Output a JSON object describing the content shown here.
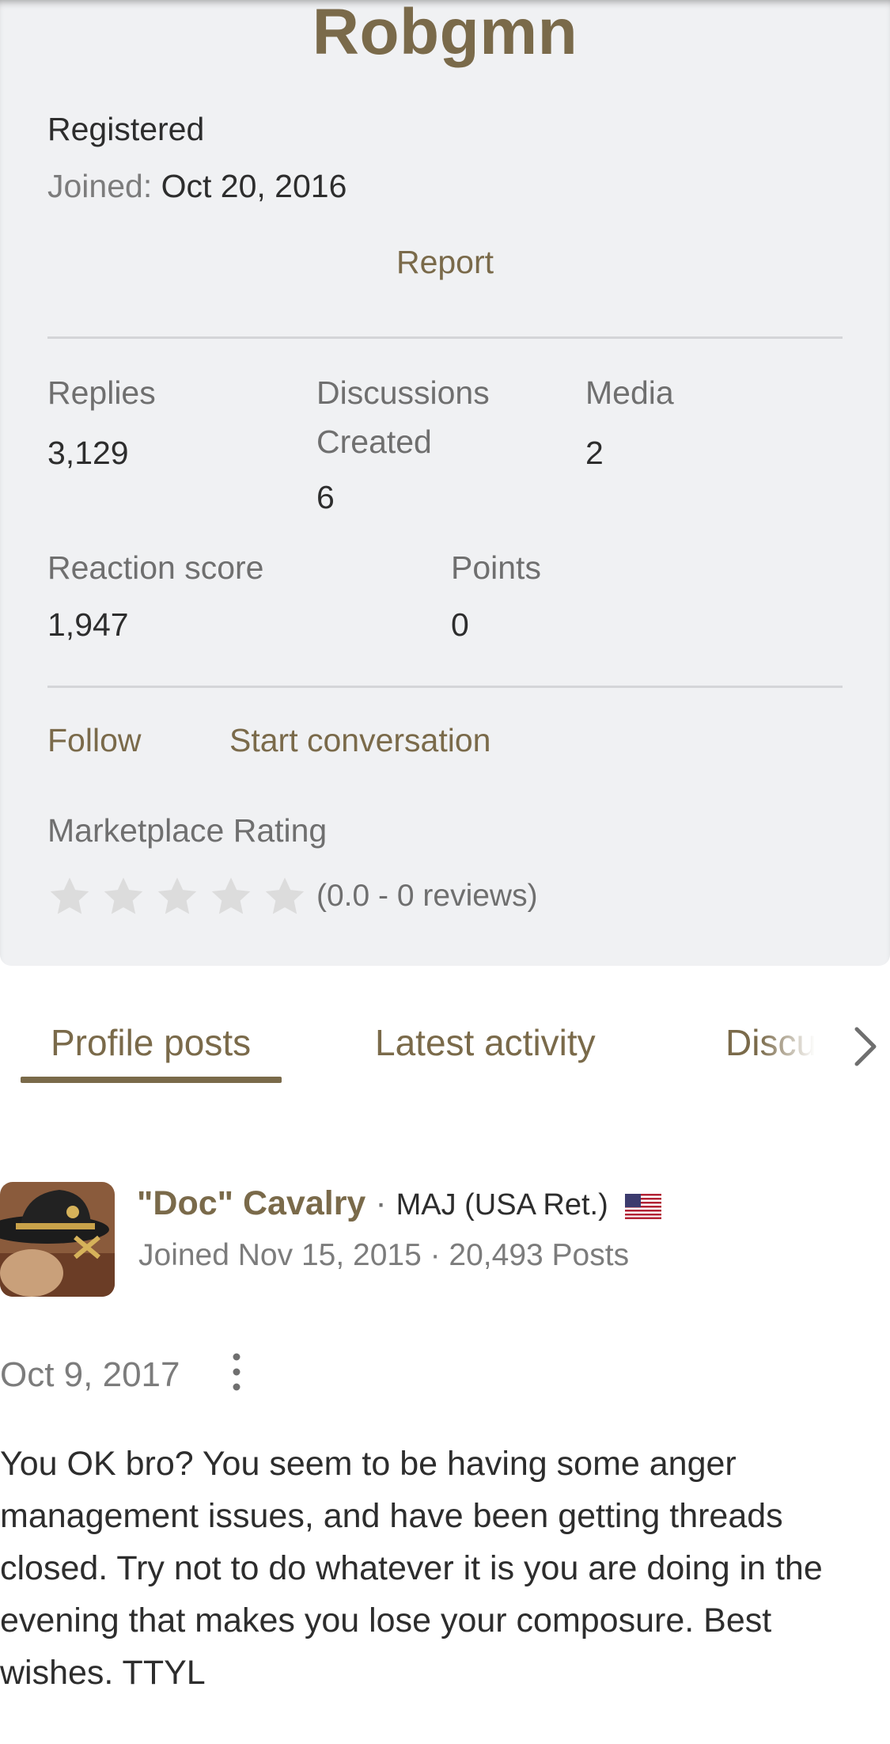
{
  "profile": {
    "username": "Robgmn",
    "status": "Registered",
    "joined_label": "Joined:",
    "joined_date": "Oct 20, 2016",
    "report_label": "Report",
    "stats": {
      "replies_label": "Replies",
      "replies_value": "3,129",
      "discussions_label_1": "Discussions",
      "discussions_label_2": "Created",
      "discussions_value": "6",
      "media_label": "Media",
      "media_value": "2",
      "reaction_label": "Reaction score",
      "reaction_value": "1,947",
      "points_label": "Points",
      "points_value": "0"
    },
    "follow_label": "Follow",
    "conversation_label": "Start conversation",
    "marketplace_title": "Marketplace Rating",
    "rating_stars": 0,
    "rating_text": "(0.0 - 0 reviews)"
  },
  "tabs": [
    {
      "label": "Profile posts",
      "active": true
    },
    {
      "label": "Latest activity",
      "active": false
    },
    {
      "label": "Discussions",
      "active": false
    }
  ],
  "post": {
    "author_name": "\"Doc\" Cavalry",
    "separator": "·",
    "author_rank": "MAJ (USA Ret.)",
    "author_meta": "Joined Nov 15, 2015 · 20,493 Posts",
    "date": "Oct 9, 2017",
    "body": "You OK bro? You seem to be having some anger management issues, and have been getting threads closed. Try not to do whatever it is you are doing in the evening that makes you lose your composure. Best wishes. TTYL"
  },
  "colors": {
    "accent": "#7a6a4a",
    "card_bg": "#f0f1f3",
    "star_empty": "#dcdcdc"
  },
  "icons": [
    "star-icon",
    "chevron-right-icon",
    "us-flag-icon",
    "more-vertical-icon",
    "avatar"
  ]
}
